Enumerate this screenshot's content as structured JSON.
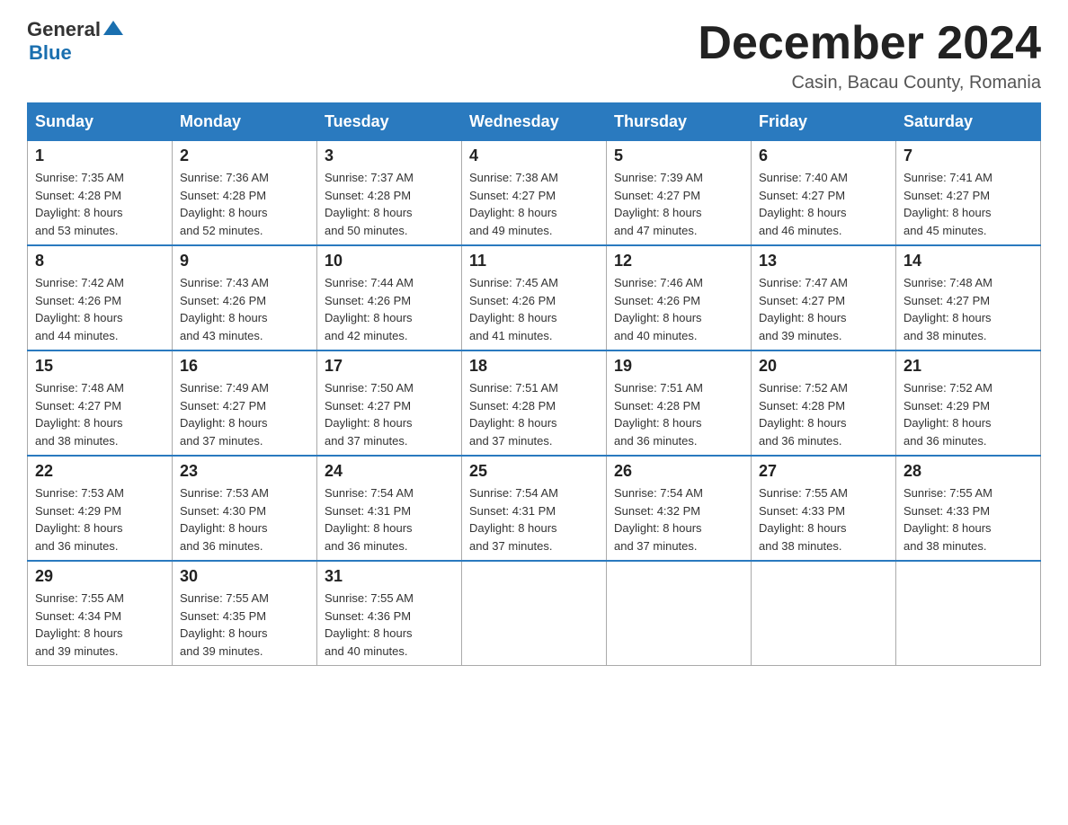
{
  "header": {
    "logo_general": "General",
    "logo_blue": "Blue",
    "month_title": "December 2024",
    "location": "Casin, Bacau County, Romania"
  },
  "days_of_week": [
    "Sunday",
    "Monday",
    "Tuesday",
    "Wednesday",
    "Thursday",
    "Friday",
    "Saturday"
  ],
  "weeks": [
    [
      {
        "day": "1",
        "sunrise": "7:35 AM",
        "sunset": "4:28 PM",
        "daylight": "8 hours and 53 minutes."
      },
      {
        "day": "2",
        "sunrise": "7:36 AM",
        "sunset": "4:28 PM",
        "daylight": "8 hours and 52 minutes."
      },
      {
        "day": "3",
        "sunrise": "7:37 AM",
        "sunset": "4:28 PM",
        "daylight": "8 hours and 50 minutes."
      },
      {
        "day": "4",
        "sunrise": "7:38 AM",
        "sunset": "4:27 PM",
        "daylight": "8 hours and 49 minutes."
      },
      {
        "day": "5",
        "sunrise": "7:39 AM",
        "sunset": "4:27 PM",
        "daylight": "8 hours and 47 minutes."
      },
      {
        "day": "6",
        "sunrise": "7:40 AM",
        "sunset": "4:27 PM",
        "daylight": "8 hours and 46 minutes."
      },
      {
        "day": "7",
        "sunrise": "7:41 AM",
        "sunset": "4:27 PM",
        "daylight": "8 hours and 45 minutes."
      }
    ],
    [
      {
        "day": "8",
        "sunrise": "7:42 AM",
        "sunset": "4:26 PM",
        "daylight": "8 hours and 44 minutes."
      },
      {
        "day": "9",
        "sunrise": "7:43 AM",
        "sunset": "4:26 PM",
        "daylight": "8 hours and 43 minutes."
      },
      {
        "day": "10",
        "sunrise": "7:44 AM",
        "sunset": "4:26 PM",
        "daylight": "8 hours and 42 minutes."
      },
      {
        "day": "11",
        "sunrise": "7:45 AM",
        "sunset": "4:26 PM",
        "daylight": "8 hours and 41 minutes."
      },
      {
        "day": "12",
        "sunrise": "7:46 AM",
        "sunset": "4:26 PM",
        "daylight": "8 hours and 40 minutes."
      },
      {
        "day": "13",
        "sunrise": "7:47 AM",
        "sunset": "4:27 PM",
        "daylight": "8 hours and 39 minutes."
      },
      {
        "day": "14",
        "sunrise": "7:48 AM",
        "sunset": "4:27 PM",
        "daylight": "8 hours and 38 minutes."
      }
    ],
    [
      {
        "day": "15",
        "sunrise": "7:48 AM",
        "sunset": "4:27 PM",
        "daylight": "8 hours and 38 minutes."
      },
      {
        "day": "16",
        "sunrise": "7:49 AM",
        "sunset": "4:27 PM",
        "daylight": "8 hours and 37 minutes."
      },
      {
        "day": "17",
        "sunrise": "7:50 AM",
        "sunset": "4:27 PM",
        "daylight": "8 hours and 37 minutes."
      },
      {
        "day": "18",
        "sunrise": "7:51 AM",
        "sunset": "4:28 PM",
        "daylight": "8 hours and 37 minutes."
      },
      {
        "day": "19",
        "sunrise": "7:51 AM",
        "sunset": "4:28 PM",
        "daylight": "8 hours and 36 minutes."
      },
      {
        "day": "20",
        "sunrise": "7:52 AM",
        "sunset": "4:28 PM",
        "daylight": "8 hours and 36 minutes."
      },
      {
        "day": "21",
        "sunrise": "7:52 AM",
        "sunset": "4:29 PM",
        "daylight": "8 hours and 36 minutes."
      }
    ],
    [
      {
        "day": "22",
        "sunrise": "7:53 AM",
        "sunset": "4:29 PM",
        "daylight": "8 hours and 36 minutes."
      },
      {
        "day": "23",
        "sunrise": "7:53 AM",
        "sunset": "4:30 PM",
        "daylight": "8 hours and 36 minutes."
      },
      {
        "day": "24",
        "sunrise": "7:54 AM",
        "sunset": "4:31 PM",
        "daylight": "8 hours and 36 minutes."
      },
      {
        "day": "25",
        "sunrise": "7:54 AM",
        "sunset": "4:31 PM",
        "daylight": "8 hours and 37 minutes."
      },
      {
        "day": "26",
        "sunrise": "7:54 AM",
        "sunset": "4:32 PM",
        "daylight": "8 hours and 37 minutes."
      },
      {
        "day": "27",
        "sunrise": "7:55 AM",
        "sunset": "4:33 PM",
        "daylight": "8 hours and 38 minutes."
      },
      {
        "day": "28",
        "sunrise": "7:55 AM",
        "sunset": "4:33 PM",
        "daylight": "8 hours and 38 minutes."
      }
    ],
    [
      {
        "day": "29",
        "sunrise": "7:55 AM",
        "sunset": "4:34 PM",
        "daylight": "8 hours and 39 minutes."
      },
      {
        "day": "30",
        "sunrise": "7:55 AM",
        "sunset": "4:35 PM",
        "daylight": "8 hours and 39 minutes."
      },
      {
        "day": "31",
        "sunrise": "7:55 AM",
        "sunset": "4:36 PM",
        "daylight": "8 hours and 40 minutes."
      },
      null,
      null,
      null,
      null
    ]
  ],
  "labels": {
    "sunrise": "Sunrise:",
    "sunset": "Sunset:",
    "daylight": "Daylight:"
  }
}
